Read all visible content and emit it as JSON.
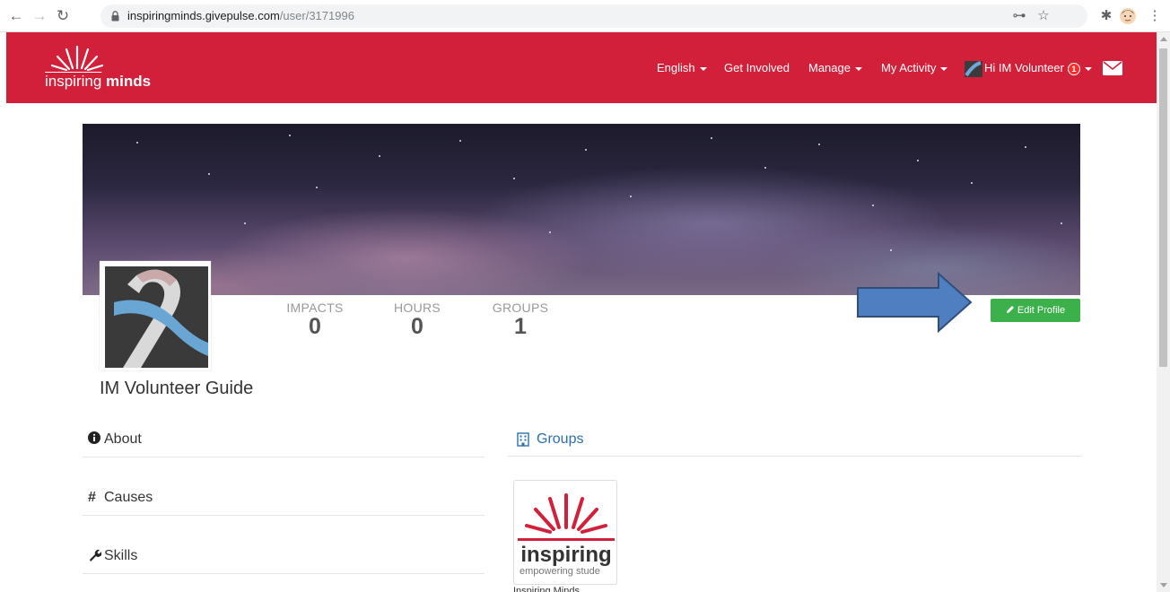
{
  "browser": {
    "url_host": "inspiringminds.givepulse.com",
    "url_path": "/user/3171996"
  },
  "header": {
    "logo_light": "inspiring",
    "logo_bold": "minds",
    "nav": {
      "language": "English",
      "get_involved": "Get Involved",
      "manage": "Manage",
      "my_activity": "My Activity",
      "greeting": "Hi IM Volunteer",
      "notification_count": "1"
    },
    "brand_color": "#d3203a"
  },
  "profile": {
    "stats": [
      {
        "label": "IMPACTS",
        "value": "0"
      },
      {
        "label": "HOURS",
        "value": "0"
      },
      {
        "label": "GROUPS",
        "value": "1"
      }
    ],
    "edit_button": "Edit Profile",
    "name": "IM Volunteer Guide"
  },
  "sections": {
    "about": "About",
    "causes": "Causes",
    "skills": "Skills"
  },
  "groups": {
    "title": "Groups",
    "items": [
      {
        "logo_word": "inspiring",
        "tagline": "empowering stude",
        "name": "Inspiring Minds"
      }
    ]
  }
}
